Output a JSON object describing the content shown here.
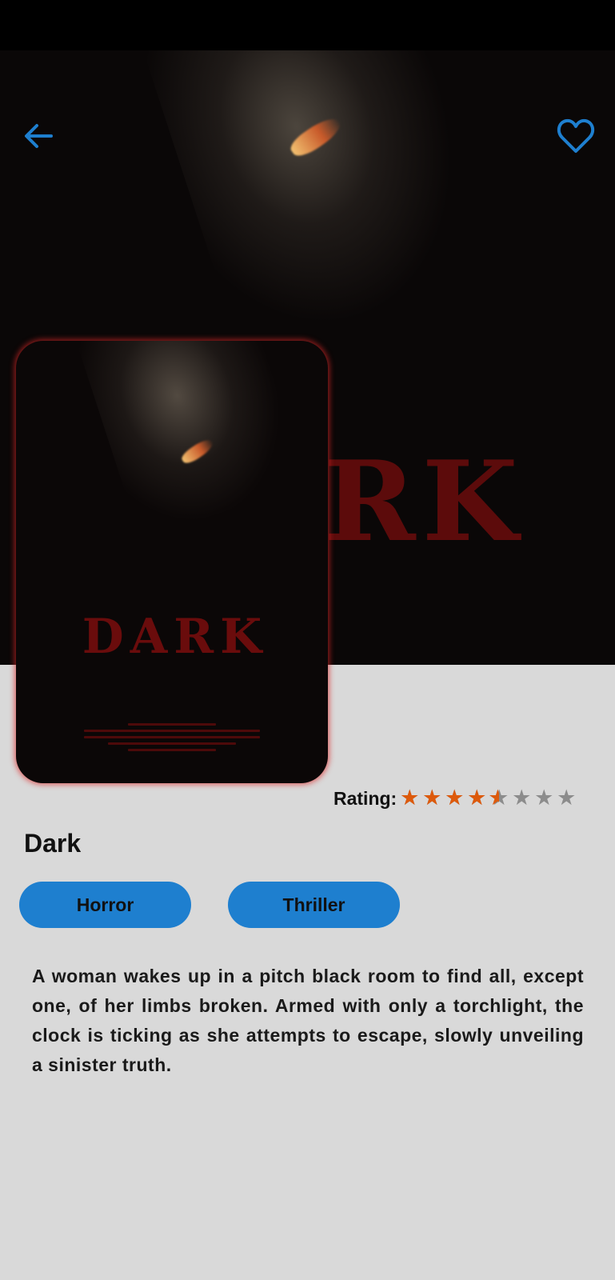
{
  "header": {
    "back_icon": "arrow-left-icon",
    "favorite_icon": "heart-outline-icon",
    "accent_color": "#1e7fcf"
  },
  "backdrop": {
    "title_art": "RK"
  },
  "poster": {
    "title_art": "DARK"
  },
  "rating": {
    "label": "Rating:",
    "value": 4.5,
    "max": 8,
    "filled_color": "#dd5a0c",
    "empty_color": "#8c8c8c"
  },
  "movie": {
    "title": "Dark",
    "genres": [
      "Horror",
      "Thriller"
    ],
    "description": "A woman wakes up in a pitch black room to find all, except one, of her limbs broken. Armed with only a torchlight, the clock is ticking as she attempts to escape, slowly unveiling a sinister truth."
  }
}
